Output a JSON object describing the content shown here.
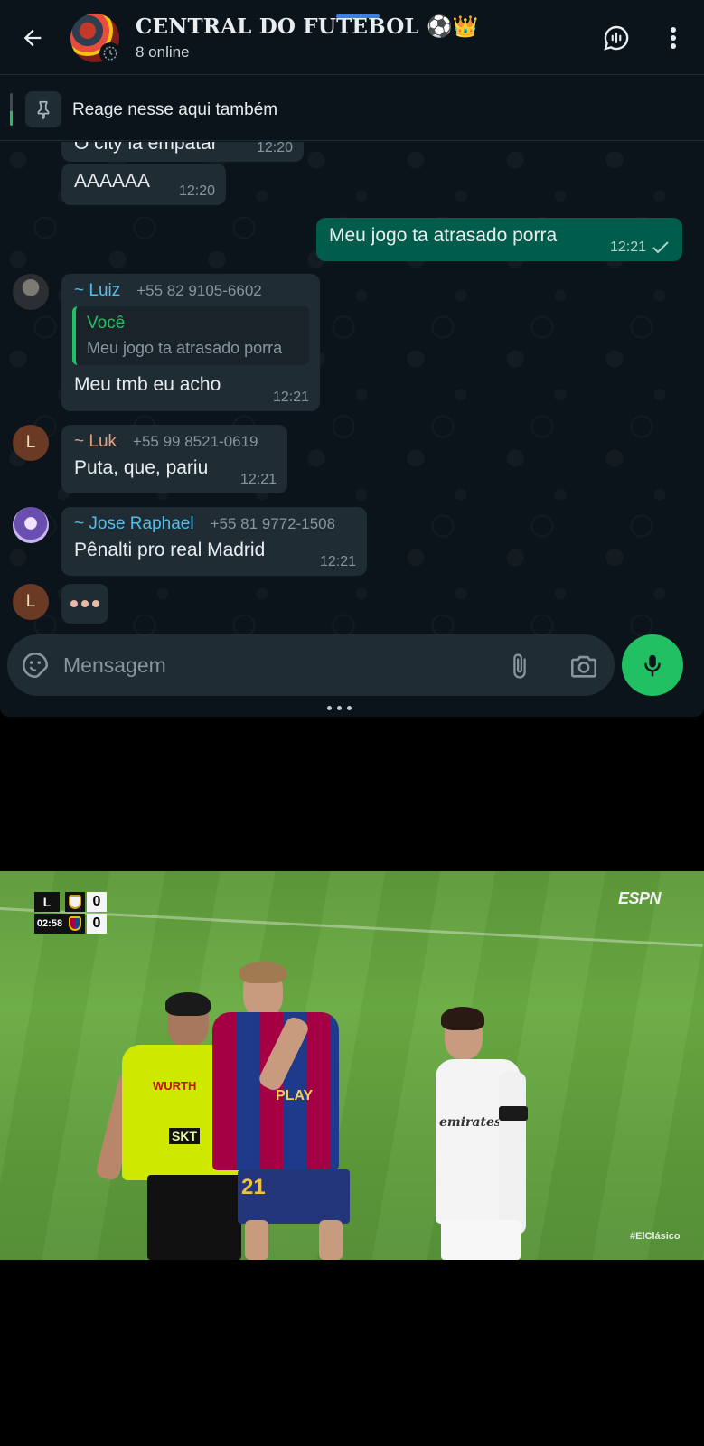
{
  "header": {
    "back_icon": "arrow-back-icon",
    "group_name": "CENTRAL DO FUTEBOL ⚽👑",
    "status": "8 online",
    "voice_chat_icon": "voice-chat-icon",
    "menu_icon": "more-vert-icon"
  },
  "pinned": {
    "icon": "pin-icon",
    "text": "Reage nesse aqui também"
  },
  "messages": [
    {
      "direction": "in",
      "text": "O city ia empatar",
      "time": "12:20"
    },
    {
      "direction": "in",
      "text": "AAAAAA",
      "time": "12:20"
    },
    {
      "direction": "out",
      "text": "Meu jogo ta atrasado porra",
      "time": "12:21",
      "status_icon": "sent-check-icon"
    },
    {
      "direction": "in",
      "sender": "~ Luiz",
      "phone": "+55 82 9105-6602",
      "sender_color": "#53bdeb",
      "quote": {
        "author": "Você",
        "text": "Meu jogo ta atrasado porra"
      },
      "text": "Meu tmb eu acho",
      "time": "12:21"
    },
    {
      "direction": "in",
      "sender": "~ Luk",
      "phone": "+55 99 8521-0619",
      "sender_color": "#e8a07c",
      "avatar_initial": "L",
      "text": "Puta, que, pariu",
      "time": "12:21"
    },
    {
      "direction": "in",
      "sender": "~ Jose Raphael",
      "phone": "+55 81 9772-1508",
      "sender_color": "#53bdeb",
      "text": "Pênalti pro real Madrid",
      "time": "12:21"
    }
  ],
  "typing": {
    "avatar_initial": "L",
    "dots": "•••"
  },
  "composer": {
    "placeholder": "Mensagem",
    "emoji_icon": "sticker-icon",
    "attach_icon": "paperclip-icon",
    "camera_icon": "camera-icon",
    "mic_icon": "mic-icon"
  },
  "video": {
    "scoreboard": {
      "league": "L",
      "clock": "02:58",
      "home_score": "0",
      "away_score": "0"
    },
    "broadcaster": "ESPN",
    "hashtag": "#ElClásico",
    "jersey_sponsor": "WURTH",
    "jersey_sponsor_badge": "SKT",
    "player_number": "21",
    "player_sponsor": "PLAY",
    "rm_sponsor": "emirates"
  },
  "colors": {
    "chat_bg": "#0b141a",
    "bubble_in": "#202c33",
    "bubble_out": "#005c4b",
    "accent_green": "#21c063",
    "name_blue": "#53bdeb",
    "name_orange": "#e8a07c"
  }
}
